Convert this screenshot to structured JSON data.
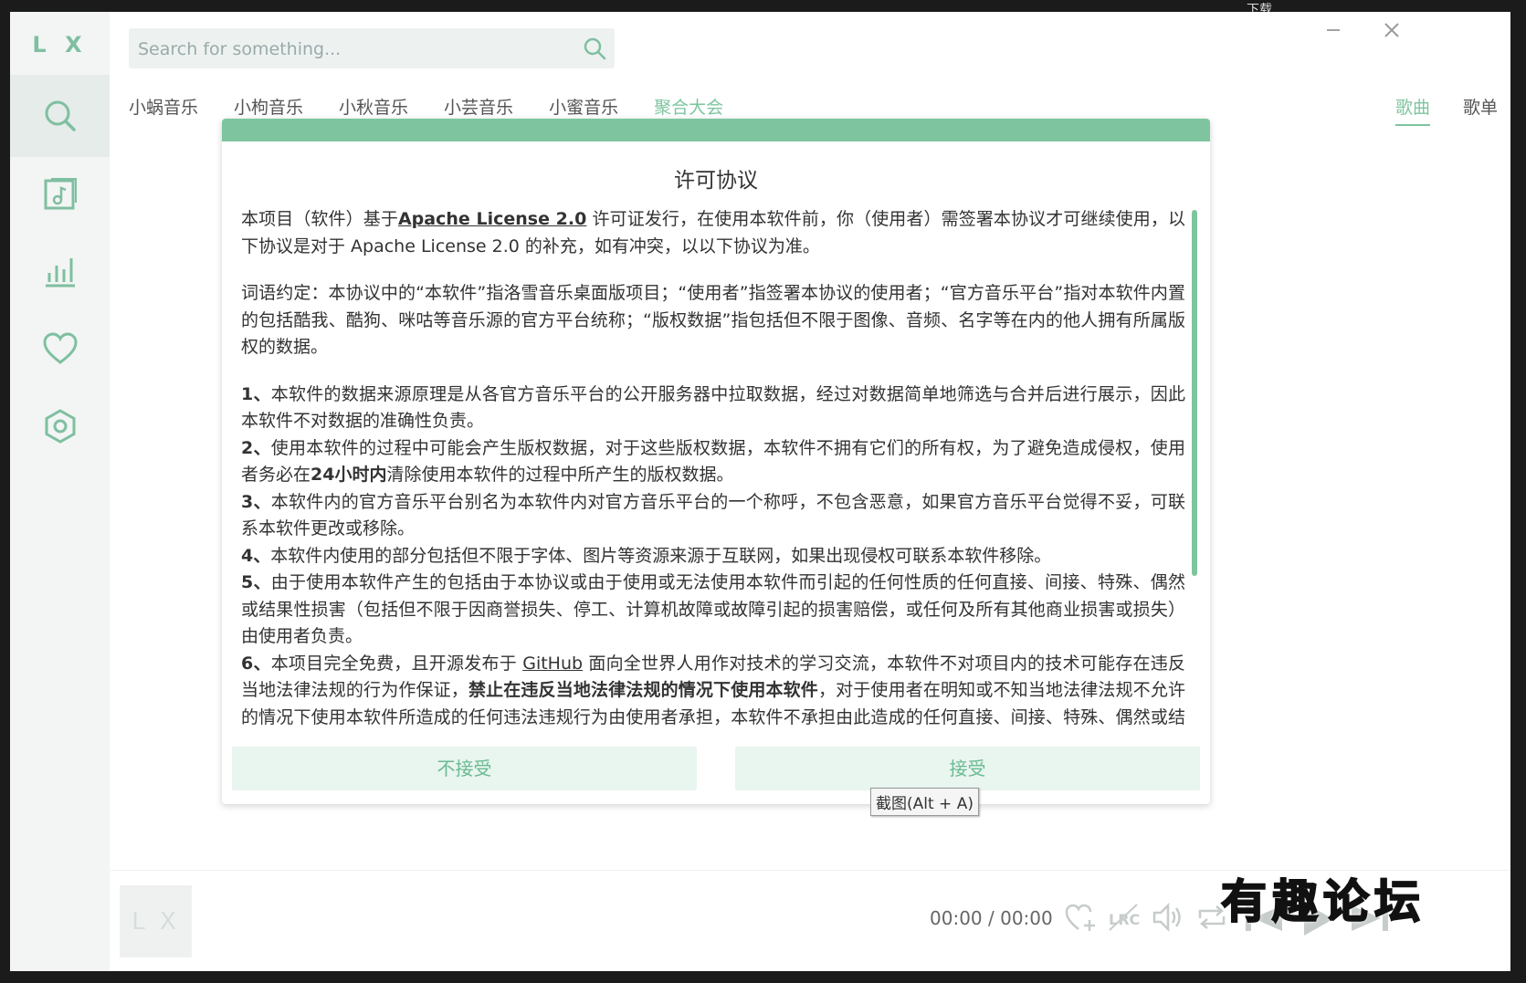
{
  "app": {
    "logo": "L X"
  },
  "search": {
    "placeholder": "Search for something..."
  },
  "sources": [
    {
      "label": "小蜗音乐",
      "active": false
    },
    {
      "label": "小枸音乐",
      "active": false
    },
    {
      "label": "小秋音乐",
      "active": false
    },
    {
      "label": "小芸音乐",
      "active": false
    },
    {
      "label": "小蜜音乐",
      "active": false
    },
    {
      "label": "聚合大会",
      "active": true
    }
  ],
  "types": [
    {
      "label": "歌曲",
      "active": true
    },
    {
      "label": "歌单",
      "active": false
    }
  ],
  "sidebar": {
    "items": [
      {
        "icon": "search-icon",
        "active": true
      },
      {
        "icon": "song-list-icon",
        "active": false
      },
      {
        "icon": "leaderboard-icon",
        "active": false
      },
      {
        "icon": "heart-icon",
        "active": false
      },
      {
        "icon": "settings-icon",
        "active": false
      }
    ]
  },
  "modal": {
    "title": "许可协议",
    "p1_a": "本项目（软件）基于",
    "p1_link": "Apache License 2.0",
    "p1_b": " 许可证发行，在使用本软件前，你（使用者）需签署本协议才可继续使用，以下协议是对于 Apache License 2.0 的补充，如有冲突，以以下协议为准。",
    "p2": "词语约定：本协议中的“本软件”指洛雪音乐桌面版项目；“使用者”指签署本协议的使用者；“官方音乐平台”指对本软件内置的包括酷我、酷狗、咪咕等音乐源的官方平台统称；“版权数据”指包括但不限于图像、音频、名字等在内的他人拥有所属版权的数据。",
    "i1_num": "1、",
    "i1": "本软件的数据来源原理是从各官方音乐平台的公开服务器中拉取数据，经过对数据简单地筛选与合并后进行展示，因此本软件不对数据的准确性负责。",
    "i2_num": "2、",
    "i2_a": "使用本软件的过程中可能会产生版权数据，对于这些版权数据，本软件不拥有它们的所有权，为了避免造成侵权，使用者务必在",
    "i2_bold": "24小时内",
    "i2_b": "清除使用本软件的过程中所产生的版权数据。",
    "i3_num": "3、",
    "i3": "本软件内的官方音乐平台别名为本软件内对官方音乐平台的一个称呼，不包含恶意，如果官方音乐平台觉得不妥，可联系本软件更改或移除。",
    "i4_num": "4、",
    "i4": "本软件内使用的部分包括但不限于字体、图片等资源来源于互联网，如果出现侵权可联系本软件移除。",
    "i5_num": "5、",
    "i5": "由于使用本软件产生的包括由于本协议或由于使用或无法使用本软件而引起的任何性质的任何直接、间接、特殊、偶然或结果性损害（包括但不限于因商誉损失、停工、计算机故障或故障引起的损害赔偿，或任何及所有其他商业损害或损失）由使用者负责。",
    "i6_num": "6、",
    "i6_a": "本项目完全免费，且开源发布于 ",
    "i6_link": "GitHub",
    "i6_b": " 面向全世界人用作对技术的学习交流，本软件不对项目内的技术可能存在违反当地法律法规的行为作保证，",
    "i6_bold": "禁止在违反当地法律法规的情况下使用本软件",
    "i6_c": "，对于使用者在明知或不知当地法律法规不允许的情况下使用本软件所造成的任何违法违规行为由使用者承担，本软件不承担由此造成的任何直接、间接、特殊、偶然或结果性责任。",
    "reject": "不接受",
    "accept": "接受"
  },
  "tooltip": "截图(Alt + A)",
  "player": {
    "cover_text": "L X",
    "time_current": "00:00",
    "time_sep": "/",
    "time_total": "00:00"
  },
  "watermark": "有趣论坛",
  "colors": {
    "accent": "#7ec59f",
    "accent_light": "#e9f5ef"
  }
}
